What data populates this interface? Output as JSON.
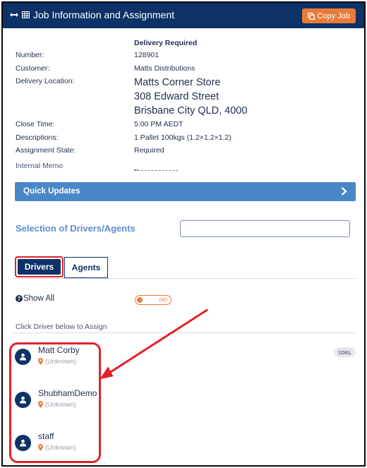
{
  "header": {
    "title": "Job Information and Assignment",
    "copy_button": "Copy Job"
  },
  "job": {
    "status_heading": "Delivery Required",
    "fields": {
      "number": {
        "label": "Number:",
        "value": "128901"
      },
      "customer": {
        "label": "Customer:",
        "value": "Matts Distributions"
      },
      "delivery_location": {
        "label": "Delivery Location:",
        "lines": [
          "Matts Corner Store",
          "308 Edward Street",
          "Brisbane City QLD, 4000"
        ]
      },
      "close_time": {
        "label": "Close Time:",
        "value": "5:00 PM AEDT"
      },
      "descriptions": {
        "label": "Descriptions:",
        "value": "1 Pallet 100kgs (1.2×1.2×1.2)"
      },
      "assignment_state": {
        "label": "Assignment State:",
        "value": "Required"
      },
      "internal_memo": {
        "label": "Internal Memo",
        "value": "_"
      }
    }
  },
  "quick_updates": {
    "label": "Quick Updates"
  },
  "selection": {
    "label": "Selection of Drivers/Agents",
    "input_value": ""
  },
  "tabs": {
    "drivers": "Drivers",
    "agents": "Agents",
    "active": "drivers"
  },
  "show_all": {
    "label": "Show All",
    "toggle_text": "NO",
    "enabled": false
  },
  "hint": "Click Driver below to Assign",
  "drivers": [
    {
      "name": "Matt Corby",
      "location": "(Unknown)",
      "badge": "1DEL"
    },
    {
      "name": "ShubhamDemo",
      "location": "(Unknown)"
    },
    {
      "name": "staff",
      "location": "(Unknown)"
    }
  ],
  "colors": {
    "header_bg": "#0e3168",
    "accent_orange": "#e87c37",
    "quick_updates_bg": "#4a87c7",
    "selection_label": "#5b8fd0",
    "annotation_red": "#e4202a"
  },
  "icons": {
    "header": [
      "arrows-horizontal-icon",
      "table-grid-icon"
    ],
    "copy": "copy-icon",
    "quick_updates": "chevron-right-icon",
    "show_all": "question-circle-icon",
    "driver_avatar": "user-icon",
    "driver_location": "map-marker-icon"
  }
}
